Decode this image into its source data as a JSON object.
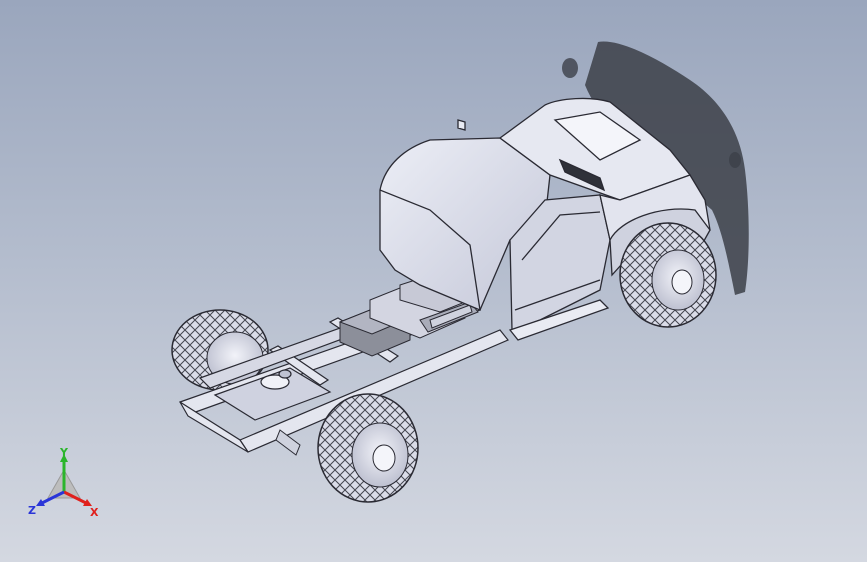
{
  "viewport": {
    "background_top": "#9aa6bd",
    "background_bottom": "#d4d8e1"
  },
  "model": {
    "kind": "truck-chassis-assembly",
    "shadow_color": "#3c4048",
    "surface_color": "#dfe1ee",
    "edge_color": "#2a2a33"
  },
  "triad": {
    "x_label": "X",
    "y_label": "Y",
    "z_label": "Z",
    "x_color": "#e0201c",
    "y_color": "#2bb52b",
    "z_color": "#2a35d8"
  }
}
